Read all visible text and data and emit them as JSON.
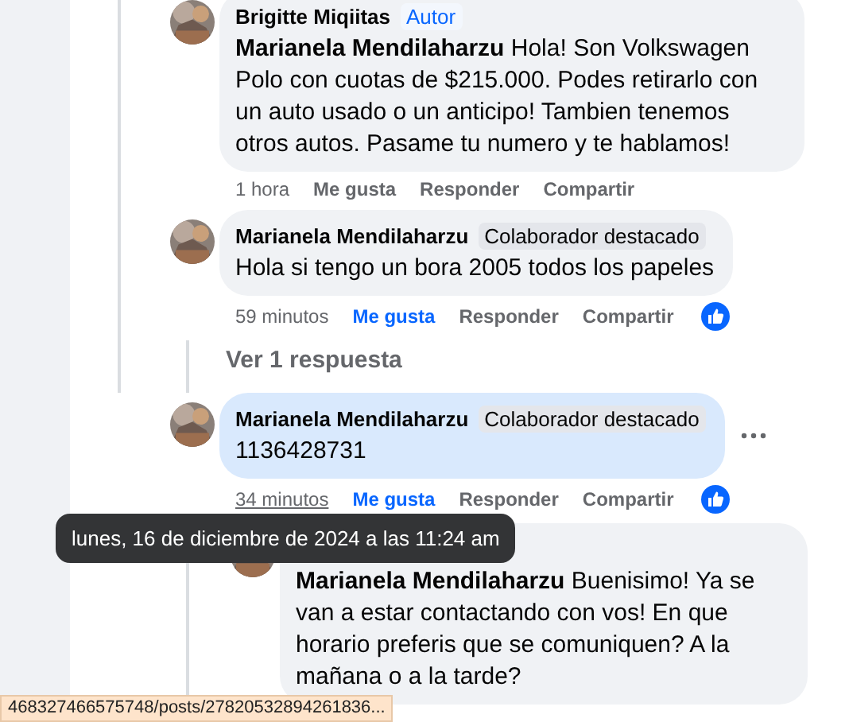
{
  "comments": [
    {
      "author": "Brigitte Miqiitas",
      "badge": {
        "text": "Autor",
        "kind": "author"
      },
      "text": "**Marianela Mendilaharzu** Hola! Son Volkswagen Polo con cuotas de $215.000. Podes retirarlo con un auto usado o un anticipo! Tambien tenemos otros autos. Pasame tu numero y te hablamos!",
      "highlighted": false,
      "actions": {
        "time": "1 hora",
        "time_hovered": false,
        "like": "Me gusta",
        "liked": false,
        "reply": "Responder",
        "share": "Compartir",
        "reaction": false
      },
      "show_menu": false
    },
    {
      "author": "Marianela Mendilaharzu",
      "badge": {
        "text": "Colaborador destacado",
        "kind": "contributor"
      },
      "text": "Hola si tengo un bora 2005 todos los papeles",
      "highlighted": false,
      "actions": {
        "time": "59 minutos",
        "time_hovered": false,
        "like": "Me gusta",
        "liked": true,
        "reply": "Responder",
        "share": "Compartir",
        "reaction": true
      },
      "replies_link": "Ver 1 respuesta",
      "show_menu": false
    },
    {
      "author": "Marianela Mendilaharzu",
      "badge": {
        "text": "Colaborador destacado",
        "kind": "contributor"
      },
      "text": "1136428731",
      "highlighted": true,
      "actions": {
        "time": "34 minutos",
        "time_hovered": true,
        "like": "Me gusta",
        "liked": true,
        "reply": "Responder",
        "share": "Compartir",
        "reaction": true
      },
      "show_menu": true,
      "children": [
        {
          "text": "**Marianela Mendilaharzu** Buenisimo! Ya se van a estar contactando con vos! En que horario preferis que se comuniquen? A la mañana o a la tarde?",
          "highlighted": false,
          "show_menu": false
        }
      ]
    }
  ],
  "tooltip": {
    "text": "lunes, 16 de diciembre de 2024 a las 11:24 am"
  },
  "status_bar": {
    "url": "468327466575748/posts/27820532894261836..."
  }
}
